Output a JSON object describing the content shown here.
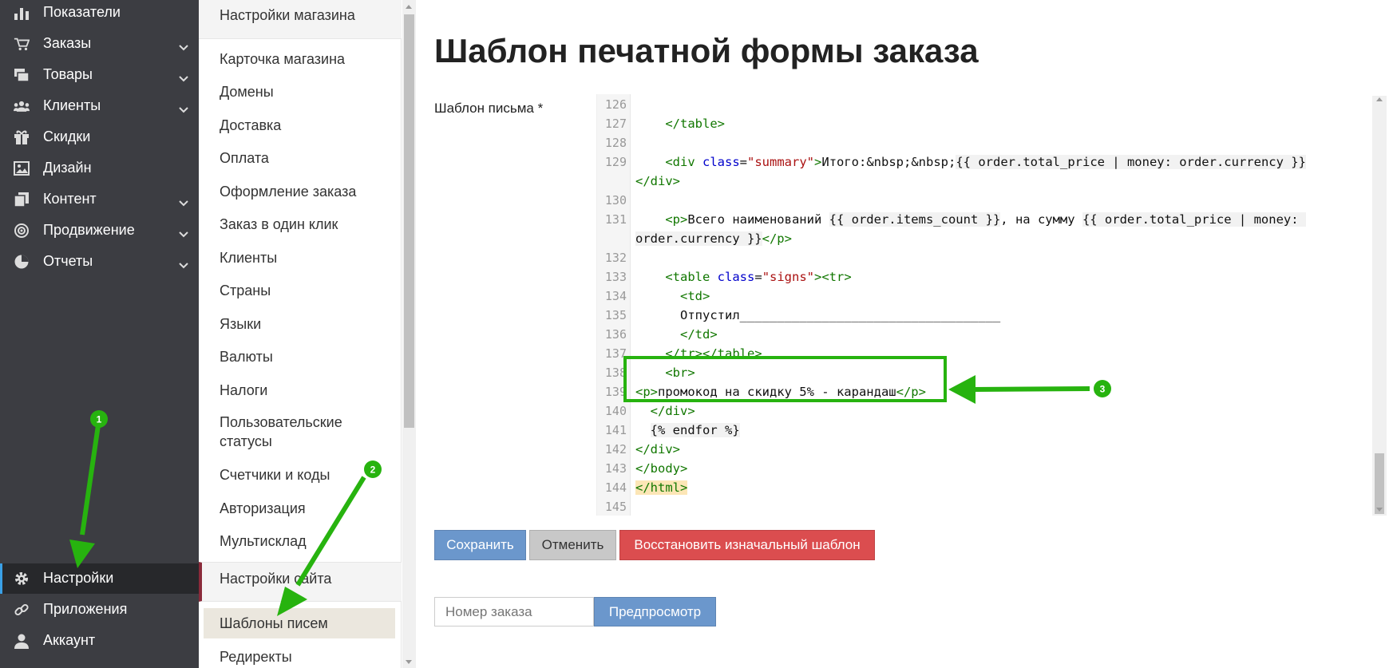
{
  "sidebar": {
    "items": [
      {
        "label": "Показатели",
        "icon": "bar-chart-icon",
        "has_chevron": false
      },
      {
        "label": "Заказы",
        "icon": "cart-icon",
        "has_chevron": true
      },
      {
        "label": "Товары",
        "icon": "layers-icon",
        "has_chevron": true
      },
      {
        "label": "Клиенты",
        "icon": "users-icon",
        "has_chevron": true
      },
      {
        "label": "Скидки",
        "icon": "gift-icon",
        "has_chevron": false
      },
      {
        "label": "Дизайн",
        "icon": "image-icon",
        "has_chevron": false
      },
      {
        "label": "Контент",
        "icon": "copy-icon",
        "has_chevron": true
      },
      {
        "label": "Продвижение",
        "icon": "target-icon",
        "has_chevron": true
      },
      {
        "label": "Отчеты",
        "icon": "pie-chart-icon",
        "has_chevron": true
      }
    ],
    "bottom_items": [
      {
        "label": "Настройки",
        "icon": "gear-icon",
        "active": true
      },
      {
        "label": "Приложения",
        "icon": "link-icon",
        "active": false
      },
      {
        "label": "Аккаунт",
        "icon": "user-icon",
        "active": false
      }
    ]
  },
  "submenu": {
    "store_header": "Настройки магазина",
    "store_items": [
      "Карточка магазина",
      "Домены",
      "Доставка",
      "Оплата",
      "Оформление заказа",
      "Заказ в один клик",
      "Клиенты",
      "Страны",
      "Языки",
      "Валюты",
      "Налоги",
      "Пользовательские статусы",
      "Счетчики и коды",
      "Авторизация",
      "Мультисклад"
    ],
    "site_header": "Настройки сайта",
    "site_items": [
      "Шаблоны писем",
      "Редиректы"
    ],
    "selected": "Шаблоны писем"
  },
  "main": {
    "title": "Шаблон печатной формы заказа",
    "field_label": "Шаблон письма *",
    "editor_lines": [
      {
        "n": "126",
        "html": ""
      },
      {
        "n": "127",
        "html": "    <span class='t'>&lt;/table&gt;</span>"
      },
      {
        "n": "128",
        "html": ""
      },
      {
        "n": "129",
        "html": "    <span class='t'>&lt;div</span> <span class='a'>class</span>=<span class='s'>\"summary\"</span><span class='t'>&gt;</span>Итого:&amp;nbsp;&amp;nbsp;<span class='b'>{{ order.total_price | money: order.currency }}</span>"
      },
      {
        "n": "",
        "html": "<span class='t'>&lt;/div&gt;</span>"
      },
      {
        "n": "130",
        "html": ""
      },
      {
        "n": "131",
        "html": "    <span class='t'>&lt;p&gt;</span>Всего наименований <span class='b'>{{ order.items_count }}</span>, на сумму <span class='b'>{{ order.total_price | money: </span>"
      },
      {
        "n": "",
        "html": "<span class='b'>order.currency }}</span><span class='t'>&lt;/p&gt;</span>"
      },
      {
        "n": "132",
        "html": ""
      },
      {
        "n": "133",
        "html": "    <span class='t'>&lt;table</span> <span class='a'>class</span>=<span class='s'>\"signs\"</span><span class='t'>&gt;&lt;tr&gt;</span>"
      },
      {
        "n": "134",
        "html": "      <span class='t'>&lt;td&gt;</span>"
      },
      {
        "n": "135",
        "html": "      Отпустил___________________________________"
      },
      {
        "n": "136",
        "html": "      <span class='t'>&lt;/td&gt;</span>"
      },
      {
        "n": "137",
        "html": "    <span class='t'>&lt;/tr&gt;&lt;/table&gt;</span>"
      },
      {
        "n": "138",
        "html": "    <span class='t'>&lt;br&gt;</span>"
      },
      {
        "n": "139",
        "html": "<span class='t'>&lt;p&gt;</span>промокод на скидку 5% - карандаш<span class='t'>&lt;/p&gt;</span>"
      },
      {
        "n": "140",
        "html": "  <span class='t'>&lt;/div&gt;</span>"
      },
      {
        "n": "141",
        "html": "  <span class='b'>{% endfor %}</span>"
      },
      {
        "n": "142",
        "html": "<span class='t'>&lt;/div&gt;</span>"
      },
      {
        "n": "143",
        "html": "<span class='t'>&lt;/body&gt;</span>"
      },
      {
        "n": "144",
        "html": "<span class='t hl'>&lt;/html&gt;</span>"
      },
      {
        "n": "145",
        "html": ""
      }
    ],
    "buttons": {
      "save": "Сохранить",
      "cancel": "Отменить",
      "restore": "Восстановить изначальный шаблон",
      "preview": "Предпросмотр"
    },
    "order_input_placeholder": "Номер заказа"
  },
  "annotations": {
    "badges": [
      "1",
      "2",
      "3"
    ],
    "color": "#27b30f"
  },
  "colors": {
    "sidebar_bg": "#3c3d42",
    "active_item_bg": "#27282b",
    "save_button": "#6b97cc",
    "cancel_button": "#c8c8c8",
    "restore_button": "#db4d4f",
    "preview_button": "#6b97cc",
    "annotation_green": "#27b30f"
  }
}
